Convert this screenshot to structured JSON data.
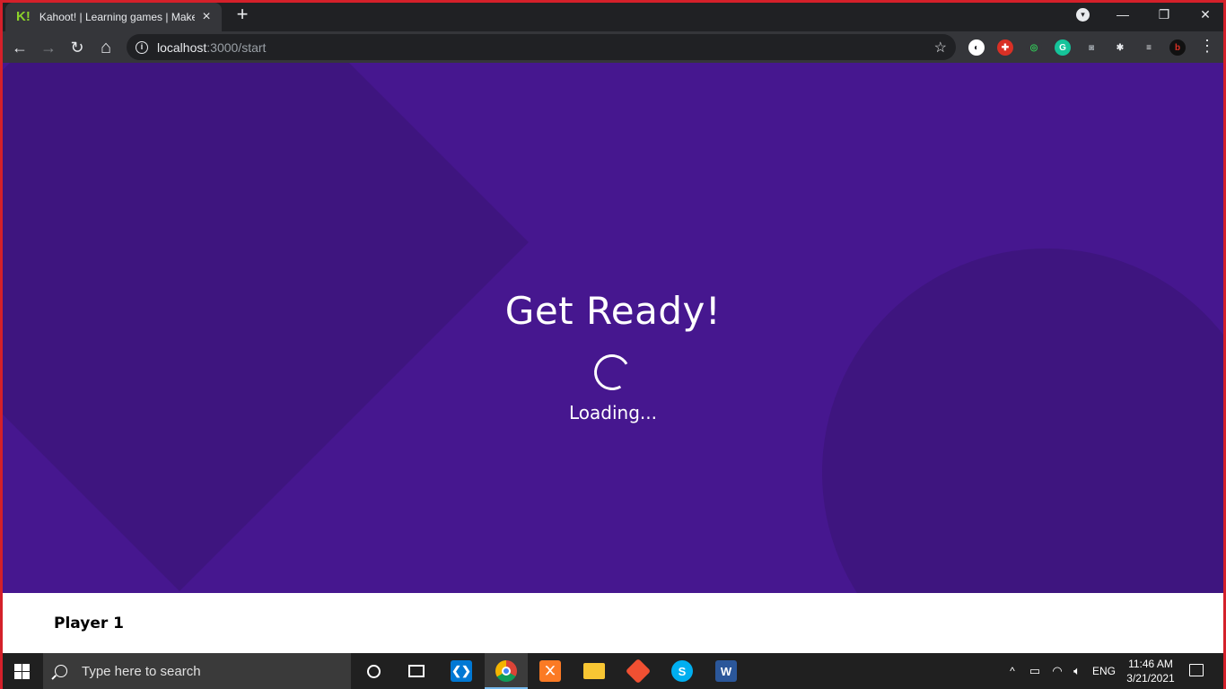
{
  "browser": {
    "tab": {
      "favicon_text": "K!",
      "title": "Kahoot! | Learning games | Make learning awesome!"
    },
    "new_tab_label": "+",
    "window_controls": {
      "minimize": "—",
      "restore": "❐",
      "close": "✕"
    },
    "toolbar": {
      "back": "←",
      "forward": "→",
      "reload": "↻",
      "home": "⌂",
      "url_host": "localhost",
      "url_path": ":3000/start",
      "star": "☆",
      "menu": "⋮"
    },
    "extensions": [
      {
        "name": "extension-1-icon",
        "glyph": "◐",
        "bg": "#ffffff",
        "fg": "#202124"
      },
      {
        "name": "extension-2-icon",
        "glyph": "✚",
        "bg": "#d93025",
        "fg": "#ffffff"
      },
      {
        "name": "extension-3-icon",
        "glyph": "◎",
        "bg": "#35363a",
        "fg": "#34c759"
      },
      {
        "name": "grammarly-icon",
        "glyph": "G",
        "bg": "#15c39a",
        "fg": "#ffffff"
      },
      {
        "name": "camera-icon",
        "glyph": "◙",
        "bg": "#35363a",
        "fg": "#9aa0a6"
      },
      {
        "name": "extensions-puzzle-icon",
        "glyph": "✱",
        "bg": "#35363a",
        "fg": "#e8eaed"
      },
      {
        "name": "media-queue-icon",
        "glyph": "≡",
        "bg": "#35363a",
        "fg": "#e8eaed"
      },
      {
        "name": "profile-avatar-icon",
        "glyph": "b",
        "bg": "#111111",
        "fg": "#d93025"
      }
    ]
  },
  "page": {
    "heading": "Get Ready!",
    "status": "Loading...",
    "player_name": "Player 1",
    "colors": {
      "background": "#46178f",
      "shape": "#3e157f"
    }
  },
  "taskbar": {
    "search_placeholder": "Type here to search",
    "apps": [
      "cortana-icon",
      "task-view-icon",
      "vscode-icon",
      "chrome-icon",
      "xampp-icon",
      "file-explorer-icon",
      "git-icon",
      "skype-icon",
      "word-icon"
    ],
    "tray": {
      "chevron": "^",
      "language": "ENG",
      "time": "11:46 AM",
      "date": "3/21/2021"
    }
  }
}
